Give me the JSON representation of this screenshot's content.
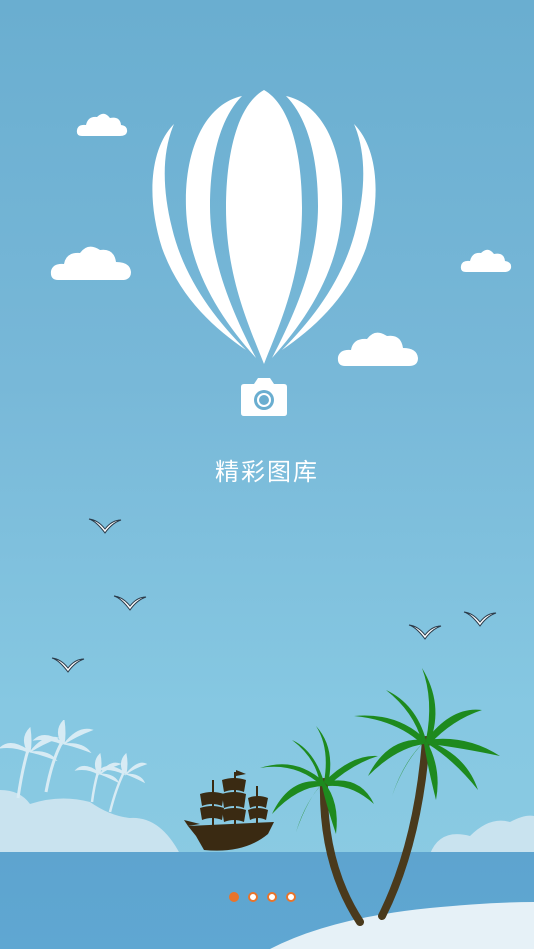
{
  "app": {
    "title": "精彩图库"
  },
  "pager": {
    "total": 4,
    "active_index": 0,
    "active_color": "#e8742b"
  },
  "icons": [
    "balloon-logo-icon",
    "camera-icon",
    "cloud-icon",
    "bird-icon",
    "palm-tree-icon",
    "ship-icon"
  ],
  "colors": {
    "sky_top": "#6aaed0",
    "sky_bottom": "#8ccbe3",
    "sea": "#5ea4cf",
    "palm_green": "#1e8a1e",
    "ship": "#3a2a12"
  }
}
